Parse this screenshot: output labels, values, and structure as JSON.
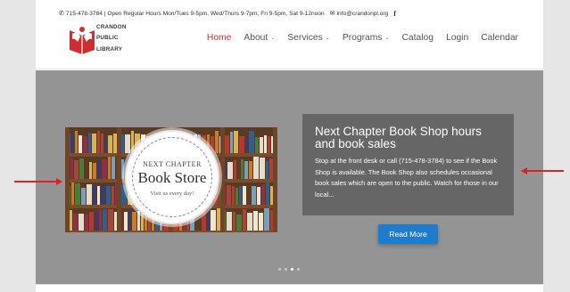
{
  "topbar": {
    "phone": "715-478-3784",
    "hours": "Open Regular Hours Mon/Tues 9-5pm, Wed/Thurs 9-7pm, Fri 9-5pm, Sat 9-12noon",
    "email": "info@crandonpl.org",
    "facebook": "f"
  },
  "logo": {
    "line1": "CRANDON",
    "line2": "PUBLIC",
    "line3": "LIBRARY",
    "color": "#cf2e2e"
  },
  "nav": {
    "items": [
      {
        "label": "Home",
        "active": true
      },
      {
        "label": "About",
        "dropdown": true
      },
      {
        "label": "Services",
        "dropdown": true
      },
      {
        "label": "Programs",
        "dropdown": true
      },
      {
        "label": "Catalog"
      },
      {
        "label": "Login"
      },
      {
        "label": "Calendar"
      }
    ],
    "chevron": "⌄"
  },
  "slide": {
    "badge_line1": "NEXT CHAPTER",
    "badge_line2": "Book Store",
    "badge_line3": "Visit us every day!",
    "title": "Next Chapter Book Shop hours and book sales",
    "body": "Stop at the front desk or call (715-478-3784) to see if the Book Shop is available. The Book Shop also schedules occasional book sales which are open to the public. Watch for those in our local...",
    "button": "Read More"
  },
  "colors": {
    "accent": "#cf2e2e",
    "button": "#1f7ccc",
    "slider_bg": "#949494"
  }
}
